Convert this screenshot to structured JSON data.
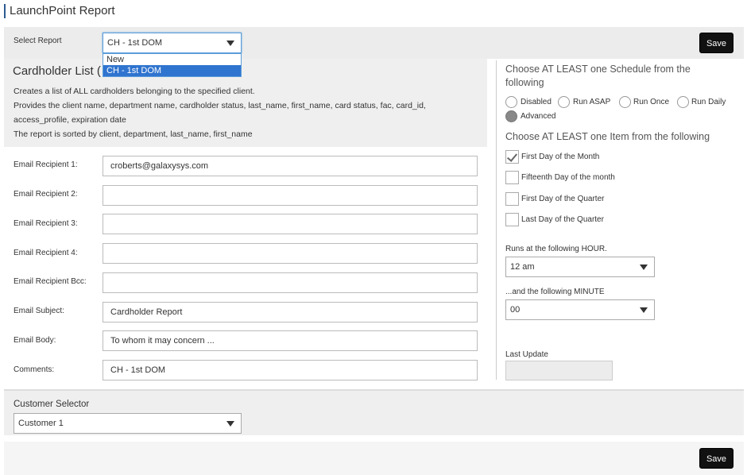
{
  "app": {
    "title": "LaunchPoint Report"
  },
  "toolbar": {
    "select_report_label": "Select Report",
    "select_report_value": "CH - 1st DOM",
    "save_label": "Save",
    "dropdown_options": [
      "New",
      "CH - 1st DOM"
    ]
  },
  "report": {
    "title": "Cardholder List (",
    "desc_lines": [
      "Creates a list of ALL cardholders belonging to the specified client.",
      "Provides the client name, department name, cardholder status, last_name, first_name, card status, fac, card_id,",
      "access_profile, expiration date",
      "The report is sorted by client, department, last_name, first_name"
    ]
  },
  "fields": [
    {
      "label": "Email Recipient 1:",
      "value": "croberts@galaxysys.com"
    },
    {
      "label": "Email Recipient 2:",
      "value": ""
    },
    {
      "label": "Email Recipient 3:",
      "value": ""
    },
    {
      "label": "Email Recipient 4:",
      "value": ""
    },
    {
      "label": "Email Recipient Bcc:",
      "value": ""
    },
    {
      "label": "Email Subject:",
      "value": "Cardholder Report"
    },
    {
      "label": "Email Body:",
      "value": "To whom it may concern ..."
    },
    {
      "label": "Comments:",
      "value": "CH - 1st DOM"
    }
  ],
  "schedule": {
    "heading_line1": "Choose AT LEAST one Schedule from the",
    "heading_line2": "following",
    "options": [
      {
        "label": "Disabled",
        "selected": false
      },
      {
        "label": "Run ASAP",
        "selected": false
      },
      {
        "label": "Run Once",
        "selected": false
      },
      {
        "label": "Run Daily",
        "selected": false
      },
      {
        "label": "Advanced",
        "selected": true
      }
    ]
  },
  "items": {
    "heading": "Choose AT LEAST one Item from the following",
    "options": [
      {
        "label": "First Day of the Month",
        "checked": true
      },
      {
        "label": "Fifteenth Day of the month",
        "checked": false
      },
      {
        "label": "First Day of the Quarter",
        "checked": false
      },
      {
        "label": "Last Day of the Quarter",
        "checked": false
      }
    ]
  },
  "timing": {
    "hour_label": "Runs at the following HOUR.",
    "hour_value": "12 am",
    "minute_label": "...and the following MINUTE",
    "minute_value": "00",
    "last_update_label": "Last Update",
    "last_update_value": ""
  },
  "customer": {
    "label": "Customer Selector",
    "value": "Customer 1"
  },
  "footer": {
    "save_label": "Save"
  }
}
